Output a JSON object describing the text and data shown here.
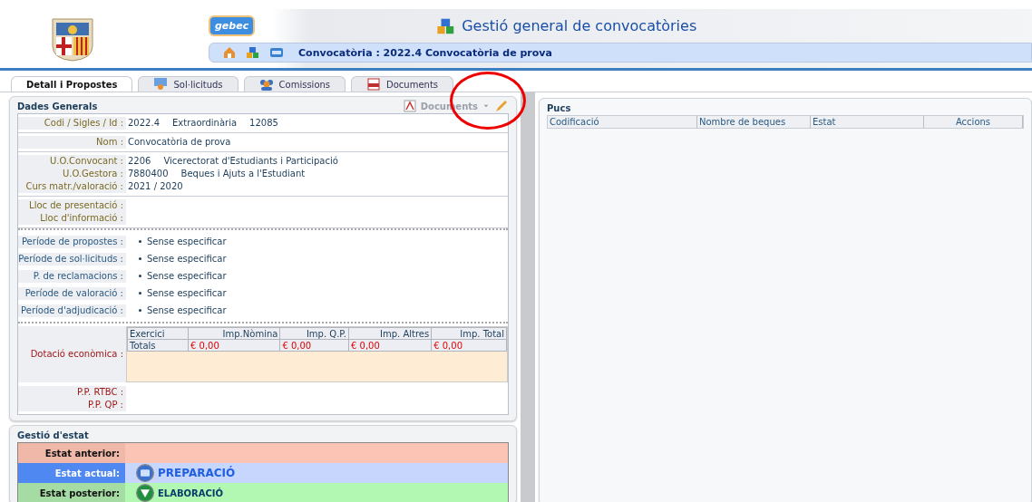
{
  "header": {
    "badge": "gebec",
    "title": "Gestió general de convocatòries",
    "breadcrumb": "Convocatòria : 2022.4 Convocatòria de prova"
  },
  "tabs": [
    {
      "label": "Detall i Propostes",
      "selected": true
    },
    {
      "label": "Sol·licituds",
      "selected": false
    },
    {
      "label": "Comissions",
      "selected": false
    },
    {
      "label": "Documents",
      "selected": false
    }
  ],
  "general": {
    "title": "Dades Generals",
    "documents_menu": "Documents",
    "groups": [
      {
        "kind": "info",
        "rows": [
          {
            "label": "Codi / Sigles / Id :",
            "values": [
              "2022.4",
              "Extraordinària",
              "12085"
            ]
          }
        ]
      },
      {
        "kind": "info",
        "rows": [
          {
            "label": "Nom :",
            "values": [
              "Convocatòria de prova"
            ]
          }
        ]
      },
      {
        "kind": "info",
        "rows": [
          {
            "label": "U.O.Convocant :",
            "values": [
              "2206",
              "Vicerectorat d'Estudiants i Participació"
            ]
          },
          {
            "label": "U.O.Gestora :",
            "values": [
              "7880400",
              "Beques i Ajuts a l'Estudiant"
            ]
          },
          {
            "label": "Curs matr./valoració :",
            "values": [
              "2021 / 2020"
            ]
          }
        ]
      },
      {
        "kind": "info",
        "rows": [
          {
            "label": "Lloc de presentació :",
            "values": []
          },
          {
            "label": "Lloc d'informació :",
            "values": []
          }
        ]
      },
      {
        "kind": "periods",
        "rows": [
          {
            "label": "Període de propostes :",
            "values": [
              "Sense especificar"
            ]
          },
          {
            "label": "Període de sol·licituds :",
            "values": [
              "Sense especificar"
            ]
          },
          {
            "label": "P. de reclamacions :",
            "values": [
              "Sense especificar"
            ]
          },
          {
            "label": "Període de valoració :",
            "values": [
              "Sense especificar"
            ]
          },
          {
            "label": "Període d'adjudicació :",
            "values": [
              "Sense especificar"
            ]
          }
        ]
      },
      {
        "kind": "budget",
        "label": "Dotació econòmica :",
        "columns": [
          "Exercici",
          "Imp.Nòmina",
          "Imp. Q.P.",
          "Imp. Altres",
          "Imp. Total"
        ],
        "totals": [
          "Totals",
          "€ 0,00",
          "€ 0,00",
          "€ 0,00",
          "€ 0,00"
        ],
        "rows": [
          {
            "label": "P.P. RTBC :",
            "values": []
          },
          {
            "label": "P.P. QP :",
            "values": []
          }
        ]
      }
    ]
  },
  "status": {
    "title": "Gestió d'estat",
    "rows": [
      {
        "kind": "previous",
        "label": "Estat anterior:"
      },
      {
        "kind": "current",
        "label": "Estat actual:",
        "value": "PREPARACIÓ"
      },
      {
        "kind": "next",
        "label": "Estat posterior:",
        "value": "ELABORACIÓ"
      }
    ]
  },
  "pucs": {
    "title": "Pucs",
    "columns": [
      "Codificació",
      "Nombre de beques",
      "Estat",
      "Accions"
    ]
  }
}
